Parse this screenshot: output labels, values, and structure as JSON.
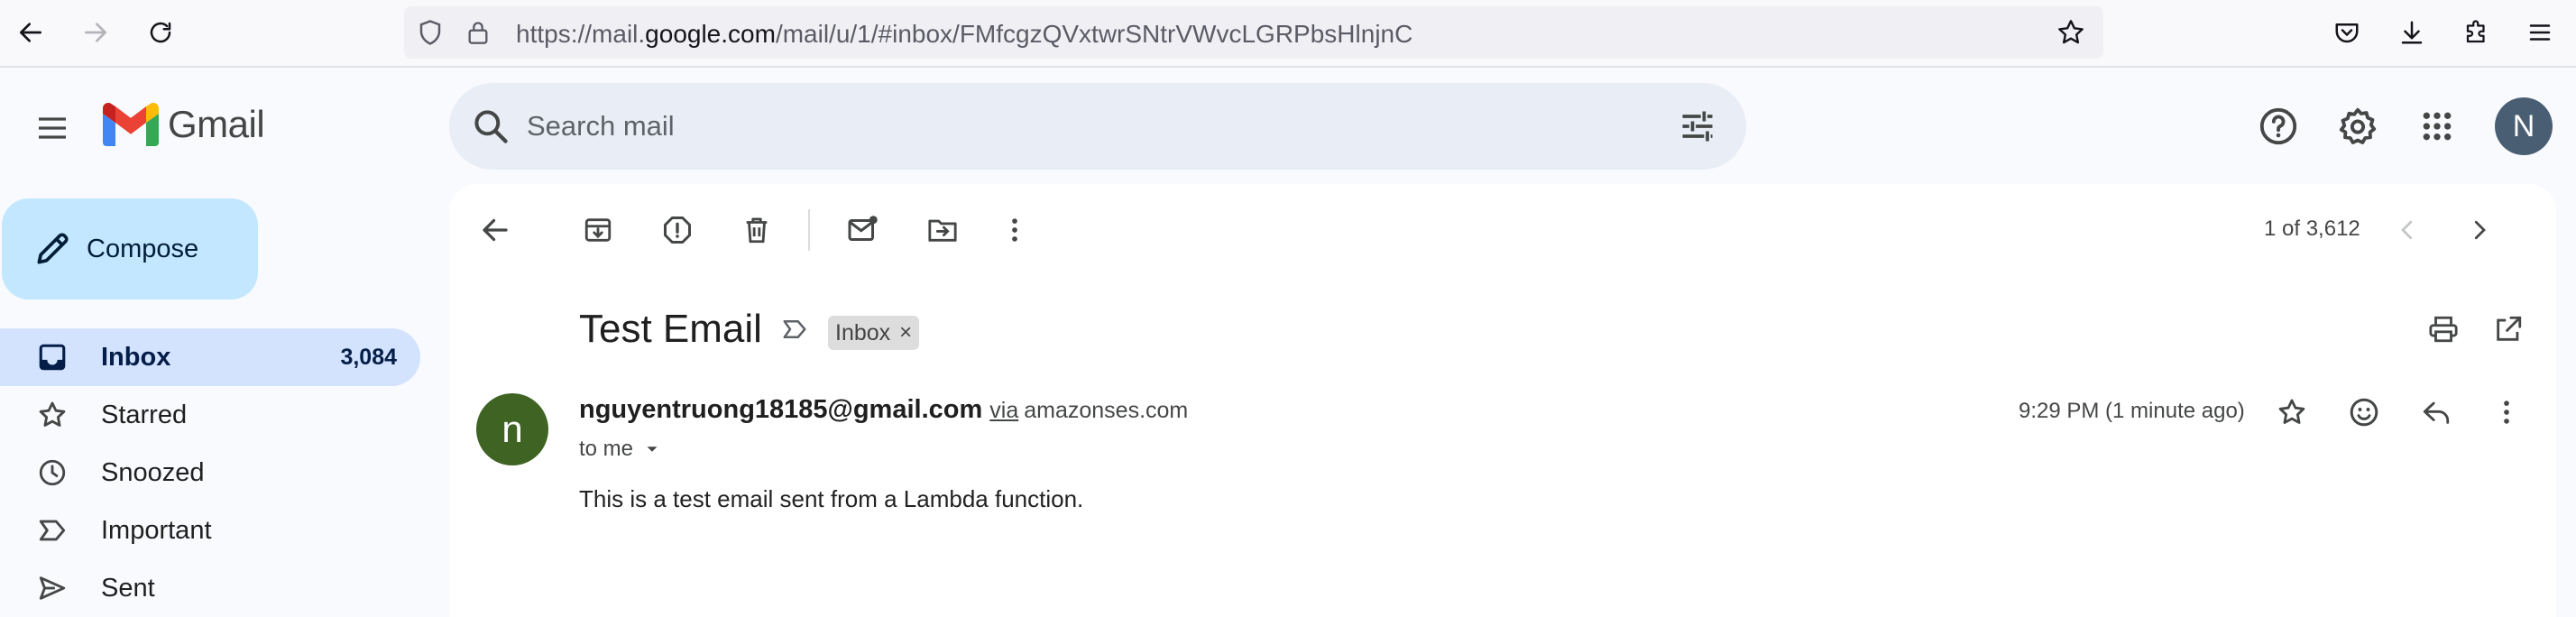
{
  "browser": {
    "url_prefix": "https://mail.",
    "url_domain": "google.com",
    "url_path": "/mail/u/1/#inbox/FMfcgzQVxtwrSNtrVWvcLGRPbsHlnjnC"
  },
  "header": {
    "app_name": "Gmail",
    "search_placeholder": "Search mail",
    "avatar_letter": "N"
  },
  "sidebar": {
    "compose_label": "Compose",
    "items": [
      {
        "label": "Inbox",
        "count": "3,084"
      },
      {
        "label": "Starred"
      },
      {
        "label": "Snoozed"
      },
      {
        "label": "Important"
      },
      {
        "label": "Sent"
      }
    ]
  },
  "toolbar": {
    "pager": "1 of 3,612"
  },
  "message": {
    "subject": "Test Email",
    "label_chip": "Inbox",
    "chip_close": "×",
    "sender_initial": "n",
    "sender_email": "nguyentruong18185@gmail.com",
    "via": "via",
    "via_domain": "amazonses.com",
    "recipient": "to me",
    "timestamp": "9:29 PM (1 minute ago)",
    "body": "This is a test email sent from a Lambda function."
  }
}
